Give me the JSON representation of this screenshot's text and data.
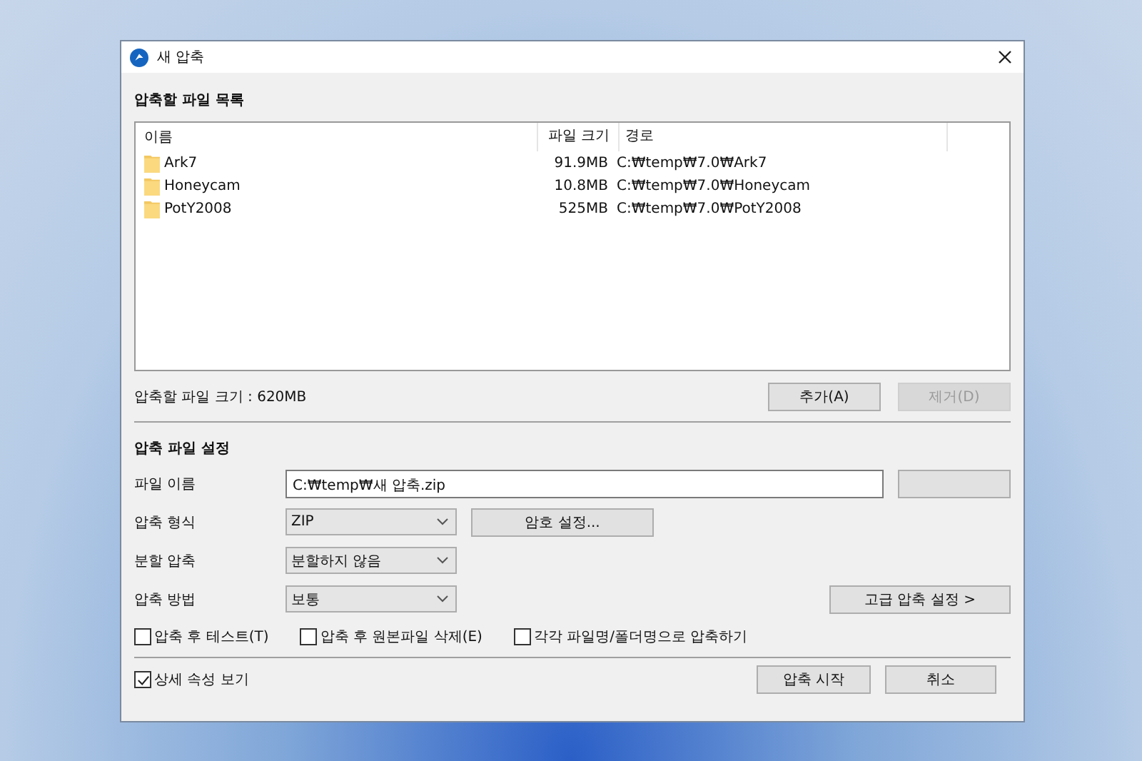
{
  "window": {
    "title": "새 압축"
  },
  "file_list": {
    "title": "압축할 파일 목록",
    "columns": [
      "이름",
      "파일 크기",
      "경로"
    ],
    "rows": [
      {
        "name": "Ark7",
        "size": "91.9MB",
        "path": "C:₩temp₩7.0₩Ark7"
      },
      {
        "name": "Honeycam",
        "size": "10.8MB",
        "path": "C:₩temp₩7.0₩Honeycam"
      },
      {
        "name": "PotY2008",
        "size": "525MB",
        "path": "C:₩temp₩7.0₩PotY2008"
      }
    ]
  },
  "total_size": "압축할 파일 크기 : 620MB",
  "list_buttons": [
    {
      "label": "추가(A)",
      "disabled": false
    },
    {
      "label": "제거(D)",
      "disabled": true
    }
  ],
  "settings": {
    "title": "압축 파일 설정",
    "file_name": {
      "label": "파일 이름",
      "value": "C:₩temp₩새 압축.zip"
    },
    "dropdowns": [
      {
        "label": "압축 형식",
        "value": "ZIP"
      },
      {
        "label": "분할 압축",
        "value": "분할하지 않음"
      },
      {
        "label": "압축 방법",
        "value": "보통"
      }
    ],
    "password_button": "암호 설정...",
    "advanced_button": "고급 압축 설정 >"
  },
  "options": [
    {
      "label": "압축 후 테스트(T)",
      "checked": false
    },
    {
      "label": "압축 후 원본파일 삭제(E)",
      "checked": false
    },
    {
      "label": "각각 파일명/폴더명으로 압축하기",
      "checked": false
    }
  ],
  "show_details": {
    "label": "상세 속성 보기",
    "checked": true
  },
  "footer_buttons": [
    "압축 시작",
    "취소"
  ]
}
